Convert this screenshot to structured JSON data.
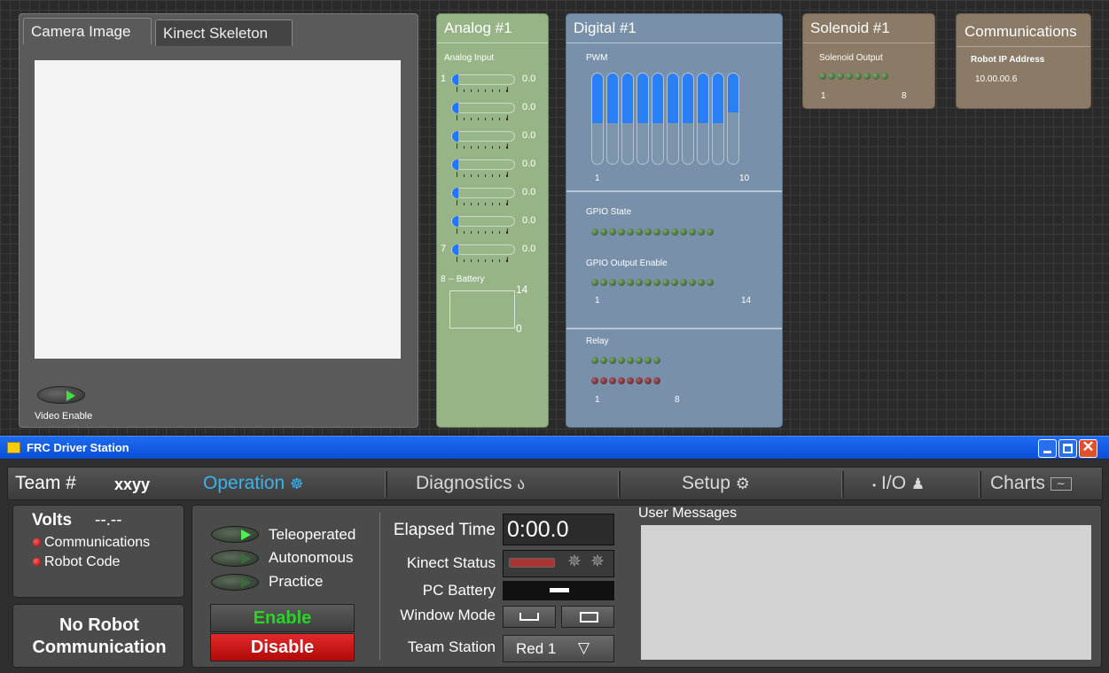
{
  "camera": {
    "tabs": [
      "Camera Image",
      "Kinect Skeleton"
    ],
    "video_enable_label": "Video Enable"
  },
  "analog": {
    "title": "Analog #1",
    "section_label": "Analog Input",
    "channels": [
      {
        "num": "1",
        "value": "0.0"
      },
      {
        "num": "",
        "value": "0.0"
      },
      {
        "num": "",
        "value": "0.0"
      },
      {
        "num": "",
        "value": "0.0"
      },
      {
        "num": "",
        "value": "0.0"
      },
      {
        "num": "",
        "value": "0.0"
      },
      {
        "num": "7",
        "value": "0.0"
      }
    ],
    "battery_label": "8 -- Battery",
    "battery_max": "14",
    "battery_min": "0"
  },
  "digital": {
    "title": "Digital #1",
    "pwm_label": "PWM",
    "pwm_values": [
      1,
      1,
      1,
      1,
      1,
      1,
      1,
      1,
      1,
      0.78
    ],
    "pwm_start": "1",
    "pwm_end": "10",
    "gpio_state_label": "GPIO State",
    "gpio_output_label": "GPIO Output Enable",
    "gpio_start": "1",
    "gpio_end": "14",
    "relay_label": "Relay",
    "relay_start": "1",
    "relay_end": "8"
  },
  "solenoid": {
    "title": "Solenoid #1",
    "section_label": "Solenoid Output",
    "start": "1",
    "end": "8"
  },
  "communications": {
    "title": "Communications",
    "ip_label": "Robot IP Address",
    "ip": "10.00.00.6"
  },
  "window": {
    "title": "FRC Driver Station"
  },
  "nav": {
    "team_label": "Team #",
    "team_value": "xxyy",
    "operation": "Operation",
    "diagnostics": "Diagnostics",
    "setup": "Setup",
    "io": "I/O",
    "charts": "Charts"
  },
  "status": {
    "volts_label": "Volts",
    "volts_value": "--.--",
    "communications": "Communications",
    "robot_code": "Robot Code",
    "no_robot_1": "No Robot",
    "no_robot_2": "Communication"
  },
  "modes": {
    "teleoperated": "Teleoperated",
    "autonomous": "Autonomous",
    "practice": "Practice",
    "enable": "Enable",
    "disable": "Disable"
  },
  "info": {
    "elapsed_label": "Elapsed Time",
    "elapsed_value": "0:00.0",
    "kinect_label": "Kinect Status",
    "battery_label": "PC Battery",
    "window_label": "Window Mode",
    "station_label": "Team Station",
    "station_value": "Red 1"
  },
  "messages": {
    "label": "User Messages"
  }
}
